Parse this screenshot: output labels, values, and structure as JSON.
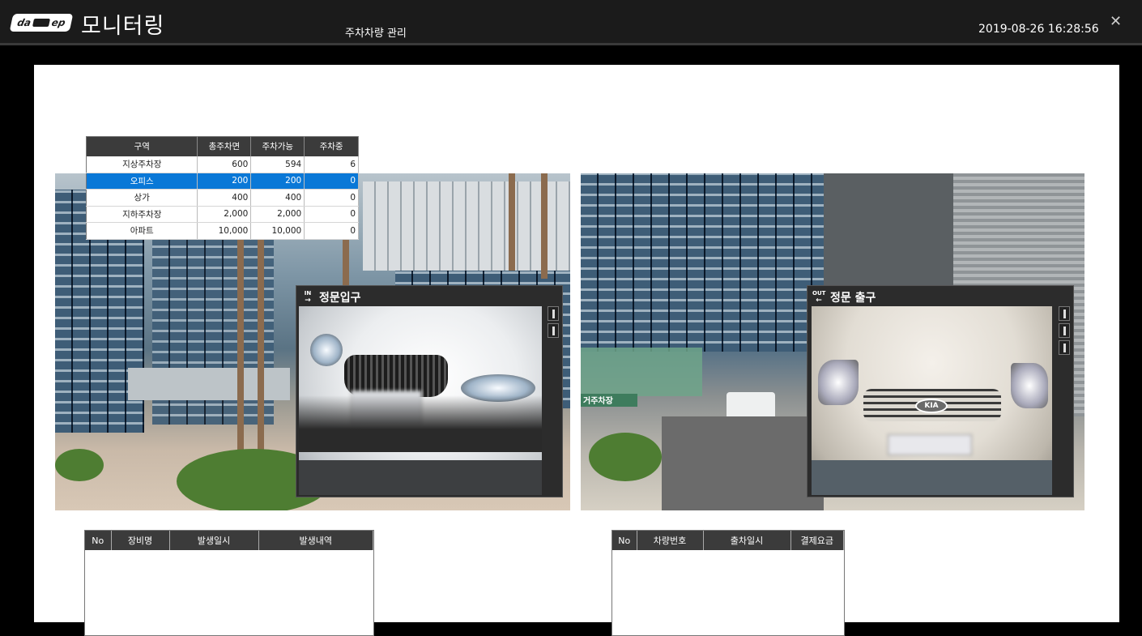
{
  "header": {
    "logo_left": "da",
    "logo_right": "ep",
    "app_title": "모니터링",
    "page_subtitle": "주차차량 관리",
    "datetime": "2019-08-26 16:28:56",
    "close_label": "✕"
  },
  "zone_table": {
    "columns": [
      "구역",
      "총주차면",
      "주차가능",
      "주차중"
    ],
    "rows": [
      [
        "지상주차장",
        "600",
        "594",
        "6"
      ],
      [
        "오피스",
        "200",
        "200",
        "0"
      ],
      [
        "상가",
        "400",
        "400",
        "0"
      ],
      [
        "지하주차장",
        "2,000",
        "2,000",
        "0"
      ],
      [
        "아파트",
        "10,000",
        "10,000",
        "0"
      ]
    ],
    "selected_row": 1,
    "selected_color": "#0a78d7"
  },
  "cameras": {
    "entrance": {
      "title": "정문입구",
      "badge": "IN",
      "arrow": "→"
    },
    "exit": {
      "title": "정문 출구",
      "badge": "OUT",
      "arrow": "←"
    }
  },
  "scene_signs": {
    "right_sign": "거주차장"
  },
  "car_badges": {
    "exit_car": "KIA"
  },
  "event_log": {
    "columns": [
      "No",
      "장비명",
      "발생일시",
      "발생내역"
    ]
  },
  "exit_log": {
    "columns": [
      "No",
      "차량번호",
      "출차일시",
      "결제요금"
    ]
  }
}
